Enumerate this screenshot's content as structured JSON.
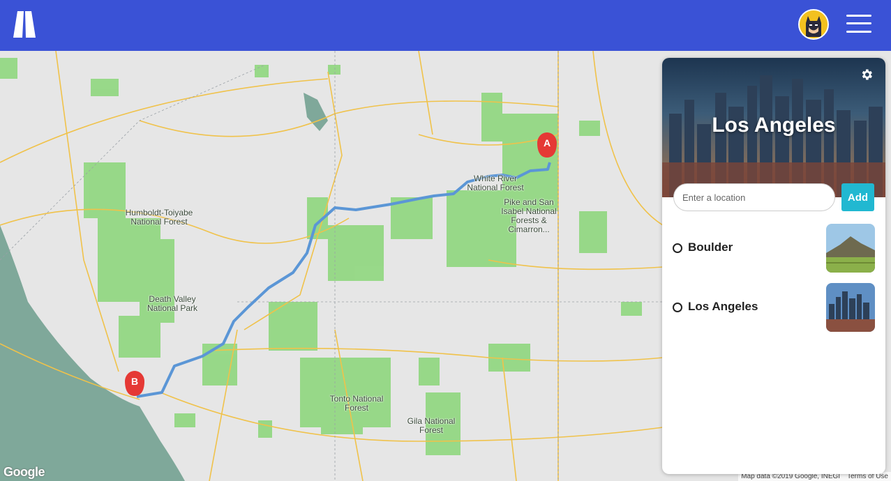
{
  "header": {
    "logo_icon": "app-logo-icon",
    "avatar_icon": "batman-avatar-icon",
    "menu_icon": "hamburger-menu-icon",
    "background": "#3a52d6"
  },
  "map": {
    "labels": [
      "White River\nNational Forest",
      "Pike and San\nIsabel National\nForests &\nCimarron...",
      "Humboldt-Toiyabe\nNational Forest",
      "Death Valley\nNational Park",
      "Tonto National\nForest",
      "Gila National\nForest"
    ],
    "markers": {
      "start": "A",
      "end": "B"
    },
    "route_color": "#5b96d6",
    "marker_color": "#e53935",
    "google_logo": "Google",
    "attribution": "Map data ©2019 Google, INEGI",
    "terms": "Terms of Use"
  },
  "panel": {
    "title": "Los Angeles",
    "settings_icon": "gear-icon",
    "input_placeholder": "Enter a location",
    "input_value": "",
    "add_label": "Add",
    "add_color": "#21b8d1",
    "places": [
      {
        "name": "Boulder",
        "thumb_icon": "boulder-thumbnail"
      },
      {
        "name": "Los Angeles",
        "thumb_icon": "los-angeles-thumbnail"
      }
    ]
  }
}
